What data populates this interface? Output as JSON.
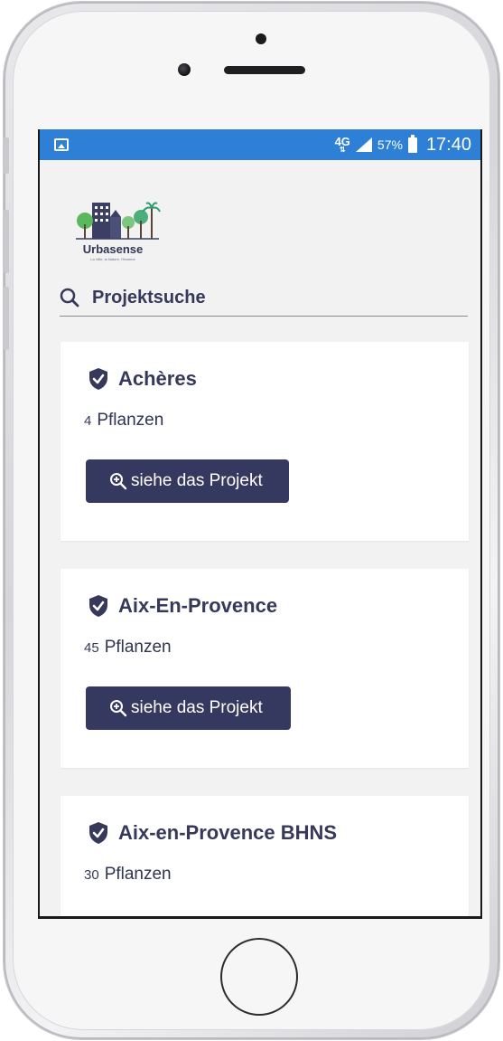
{
  "status_bar": {
    "network": "4G",
    "battery_percent": "57%",
    "time": "17:40",
    "color": "#2e7fd6"
  },
  "app": {
    "logo_name": "Urbasense",
    "logo_tagline": "La Ville, la Nature, l'Homme",
    "search_title": "Projektsuche",
    "accent_color": "#36395f"
  },
  "projects": [
    {
      "name": "Achères",
      "count": "4",
      "count_label": "Pflanzen",
      "button_label": "siehe das Projekt"
    },
    {
      "name": "Aix-En-Provence",
      "count": "45",
      "count_label": "Pflanzen",
      "button_label": "siehe das Projekt"
    },
    {
      "name": "Aix-en-Provence BHNS",
      "count": "30",
      "count_label": "Pflanzen"
    }
  ]
}
